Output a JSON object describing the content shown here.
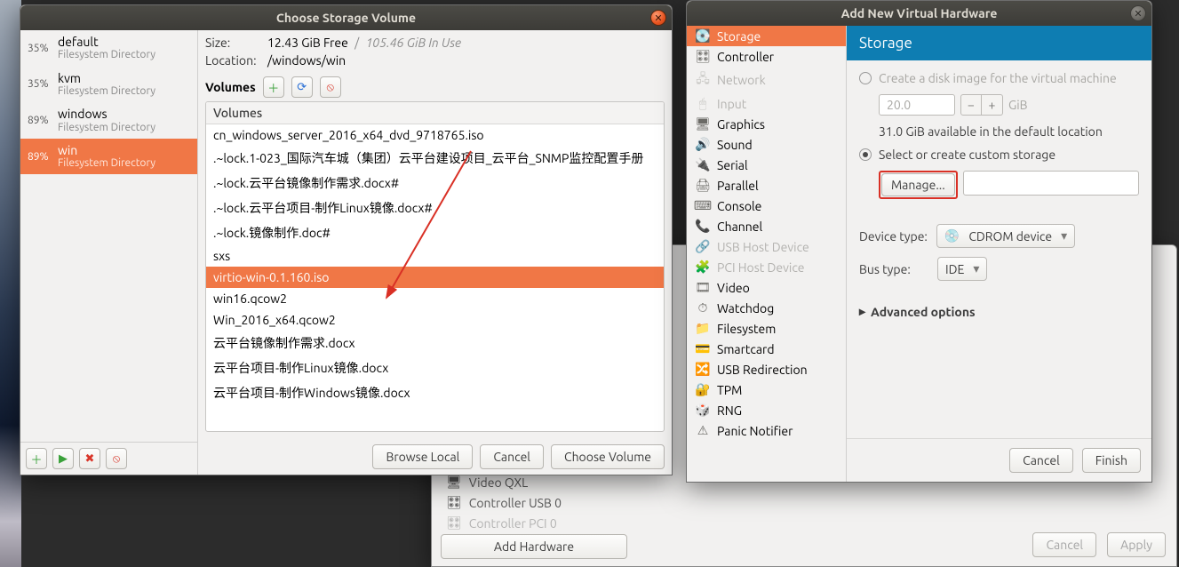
{
  "storage_dialog": {
    "title": "Choose Storage Volume",
    "size_label": "Size:",
    "size_free": "12.43 GiB Free",
    "size_sep": "/",
    "size_used": "105.46 GiB In Use",
    "location_label": "Location:",
    "location_value": "/windows/win",
    "volumes_label": "Volumes",
    "table_header": "Volumes",
    "pools": [
      {
        "pct": "35%",
        "name": "default",
        "sub": "Filesystem Directory",
        "selected": false
      },
      {
        "pct": "35%",
        "name": "kvm",
        "sub": "Filesystem Directory",
        "selected": false
      },
      {
        "pct": "89%",
        "name": "windows",
        "sub": "Filesystem Directory",
        "selected": false
      },
      {
        "pct": "89%",
        "name": "win",
        "sub": "Filesystem Directory",
        "selected": true
      }
    ],
    "volumes": [
      {
        "name": "cn_windows_server_2016_x64_dvd_9718765.iso"
      },
      {
        "name": ".~lock.1-023_国际汽车城（集团）云平台建设项目_云平台_SNMP监控配置手册"
      },
      {
        "name": ".~lock.云平台镜像制作需求.docx#"
      },
      {
        "name": ".~lock.云平台项目-制作Linux镜像.docx#"
      },
      {
        "name": ".~lock.镜像制作.doc#"
      },
      {
        "name": "sxs"
      },
      {
        "name": "virtio-win-0.1.160.iso",
        "selected": true
      },
      {
        "name": "win16.qcow2"
      },
      {
        "name": "Win_2016_x64.qcow2"
      },
      {
        "name": "云平台镜像制作需求.docx"
      },
      {
        "name": "云平台项目-制作Linux镜像.docx"
      },
      {
        "name": "云平台项目-制作Windows镜像.docx"
      }
    ],
    "pool_tool_icons": {
      "add": "＋",
      "play": "▶",
      "stop": "✖",
      "no": "⦸"
    },
    "vol_tool_icons": {
      "add": "＋",
      "refresh": "⟳",
      "delete": "⦸"
    },
    "buttons": {
      "browse": "Browse Local",
      "cancel": "Cancel",
      "choose": "Choose Volume"
    }
  },
  "addhw_dialog": {
    "title": "Add New Virtual Hardware",
    "panel_title": "Storage",
    "hw_types": [
      {
        "name": "Storage",
        "icon": "i-disk",
        "selected": true
      },
      {
        "name": "Controller",
        "icon": "i-ctrl"
      },
      {
        "name": "Network",
        "icon": "i-net",
        "disabled": true
      },
      {
        "name": "Input",
        "icon": "i-input",
        "disabled": true
      },
      {
        "name": "Graphics",
        "icon": "i-gfx"
      },
      {
        "name": "Sound",
        "icon": "i-sound"
      },
      {
        "name": "Serial",
        "icon": "i-serial"
      },
      {
        "name": "Parallel",
        "icon": "i-par"
      },
      {
        "name": "Console",
        "icon": "i-con"
      },
      {
        "name": "Channel",
        "icon": "i-chan"
      },
      {
        "name": "USB Host Device",
        "icon": "i-usb",
        "disabled": true
      },
      {
        "name": "PCI Host Device",
        "icon": "i-pci",
        "disabled": true
      },
      {
        "name": "Video",
        "icon": "i-vid"
      },
      {
        "name": "Watchdog",
        "icon": "i-dog"
      },
      {
        "name": "Filesystem",
        "icon": "i-fs"
      },
      {
        "name": "Smartcard",
        "icon": "i-smart"
      },
      {
        "name": "USB Redirection",
        "icon": "i-usbr"
      },
      {
        "name": "TPM",
        "icon": "i-tpm"
      },
      {
        "name": "RNG",
        "icon": "i-rng"
      },
      {
        "name": "Panic Notifier",
        "icon": "i-panic"
      }
    ],
    "radio_create_label": "Create a disk image for the virtual machine",
    "disk_size_value": "20.0",
    "disk_size_unit": "GiB",
    "available_text": "31.0 GiB available in the default location",
    "radio_select_label": "Select or create custom storage",
    "manage_label": "Manage...",
    "device_type_label": "Device type:",
    "device_type_value": "CDROM device",
    "device_type_icon": "💿",
    "bus_type_label": "Bus type:",
    "bus_type_value": "IDE",
    "advanced_label": "Advanced options",
    "buttons": {
      "cancel": "Cancel",
      "finish": "Finish"
    }
  },
  "vm_details": {
    "sidebar": [
      {
        "label": "Video QXL",
        "icon": "🖥"
      },
      {
        "label": "Controller USB 0",
        "icon": "🎛"
      },
      {
        "label": "Controller PCI 0",
        "icon": "🎛"
      }
    ],
    "add_hw": "Add Hardware",
    "footer": {
      "cancel": "Cancel",
      "apply": "Apply"
    }
  }
}
